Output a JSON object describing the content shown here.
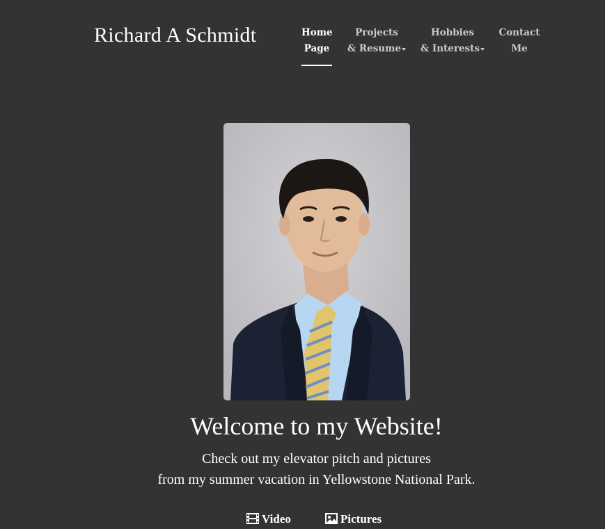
{
  "header": {
    "site_title": "Richard A Schmidt"
  },
  "nav": {
    "items": [
      {
        "line1": "Home",
        "line2": "Page",
        "active": true,
        "dropdown": false
      },
      {
        "line1": "Projects",
        "line2": "& Resume",
        "active": false,
        "dropdown": true
      },
      {
        "line1": "Hobbies",
        "line2": "& Interests",
        "active": false,
        "dropdown": true
      },
      {
        "line1": "Contact",
        "line2": "Me",
        "active": false,
        "dropdown": false
      }
    ]
  },
  "hero": {
    "heading": "Welcome to my Website!",
    "intro_line1": "Check out my elevator pitch and pictures",
    "intro_line2": "from my summer vacation in Yellowstone National Park."
  },
  "media_links": {
    "video_label": "Video",
    "video_icon": "film-icon",
    "pictures_label": "Pictures",
    "pictures_icon": "picture-icon"
  },
  "colors": {
    "background": "#333333",
    "text": "#ffffff",
    "nav_inactive": "#c9c9c9",
    "photo_backdrop": "#c4c3c6"
  }
}
